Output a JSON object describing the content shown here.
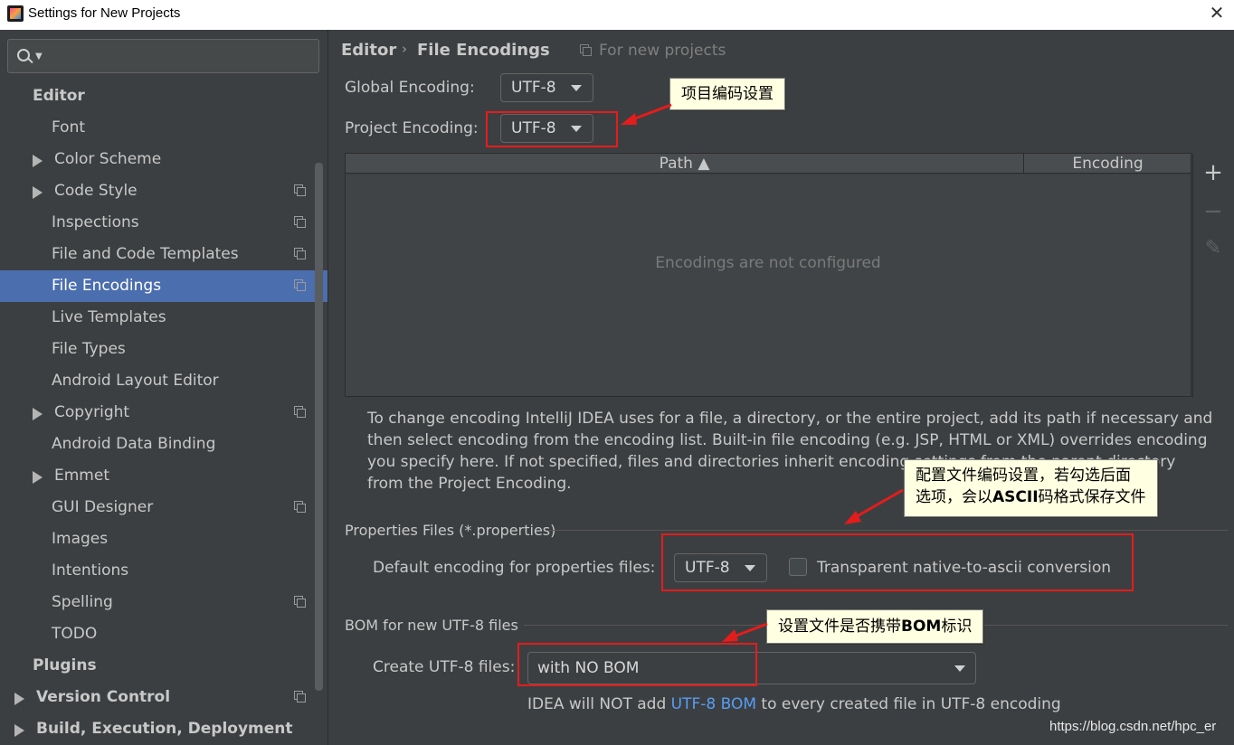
{
  "window": {
    "title": "Settings for New Projects",
    "close_glyph": "✕"
  },
  "sidebar": {
    "search": {
      "value": "",
      "placeholder": ""
    },
    "items": [
      {
        "label": "Editor",
        "level": 0,
        "bold": true
      },
      {
        "label": "Font",
        "level": 1
      },
      {
        "label": "Color Scheme",
        "level": 1,
        "expandable": true
      },
      {
        "label": "Code Style",
        "level": 1,
        "expandable": true,
        "project_icon": true
      },
      {
        "label": "Inspections",
        "level": 1,
        "project_icon": true
      },
      {
        "label": "File and Code Templates",
        "level": 1,
        "project_icon": true
      },
      {
        "label": "File Encodings",
        "level": 1,
        "project_icon": true,
        "selected": true
      },
      {
        "label": "Live Templates",
        "level": 1
      },
      {
        "label": "File Types",
        "level": 1
      },
      {
        "label": "Android Layout Editor",
        "level": 1
      },
      {
        "label": "Copyright",
        "level": 1,
        "expandable": true,
        "project_icon": true
      },
      {
        "label": "Android Data Binding",
        "level": 1
      },
      {
        "label": "Emmet",
        "level": 1,
        "expandable": true
      },
      {
        "label": "GUI Designer",
        "level": 1,
        "project_icon": true
      },
      {
        "label": "Images",
        "level": 1
      },
      {
        "label": "Intentions",
        "level": 1
      },
      {
        "label": "Spelling",
        "level": 1,
        "project_icon": true
      },
      {
        "label": "TODO",
        "level": 1
      },
      {
        "label": "Plugins",
        "level": 0,
        "bold": true
      },
      {
        "label": "Version Control",
        "level": 0,
        "bold": true,
        "expandable": true,
        "project_icon": true
      },
      {
        "label": "Build, Execution, Deployment",
        "level": 0,
        "bold": true,
        "expandable": true
      }
    ]
  },
  "main": {
    "breadcrumb": {
      "root": "Editor",
      "separator": "›",
      "current": "File Encodings"
    },
    "scope_note": "For new projects",
    "global_encoding": {
      "label": "Global Encoding:",
      "value": "UTF-8"
    },
    "project_encoding": {
      "label": "Project Encoding:",
      "value": "UTF-8"
    },
    "table": {
      "columns": [
        "Path ▲",
        "Encoding"
      ],
      "empty_text": "Encodings are not configured",
      "tools": [
        "+",
        "−",
        "✎"
      ]
    },
    "help_lines": [
      "To change encoding IntelliJ IDEA uses for a file, a directory, or the entire project, add its path if necessary and",
      "then select encoding from the encoding list. Built-in file encoding (e.g. JSP, HTML or XML) overrides encoding",
      "you specify here. If not specified, files and directories inherit encoding settings from the parent directory",
      "from the Project Encoding."
    ],
    "properties": {
      "section": "Properties Files (*.properties)",
      "label": "Default encoding for properties files:",
      "value": "UTF-8",
      "checkbox_label": "Transparent native-to-ascii conversion",
      "checked": false
    },
    "bom": {
      "section": "BOM for new UTF-8 files",
      "label": "Create UTF-8 files:",
      "value": "with NO BOM",
      "hint_prefix": "IDEA will NOT add ",
      "hint_link": "UTF-8 BOM",
      "hint_suffix": " to every created file in UTF-8 encoding"
    }
  },
  "annotations": {
    "project_encoding": "项目编码设置",
    "properties_line1": "配置文件编码设置，若勾选后面",
    "properties_line2_a": "选项，会以",
    "properties_line2_b": "ASCII",
    "properties_line2_c": "码格式保存文件",
    "bom_a": "设置文件是否携带",
    "bom_b": "BOM",
    "bom_c": "标识"
  },
  "watermark": "https://blog.csdn.net/hpc_er",
  "colors": {
    "selection": "#4b6eaf",
    "link": "#589df6",
    "annotation_box": "#e51c1c",
    "callout_bg": "#ffffe1"
  }
}
